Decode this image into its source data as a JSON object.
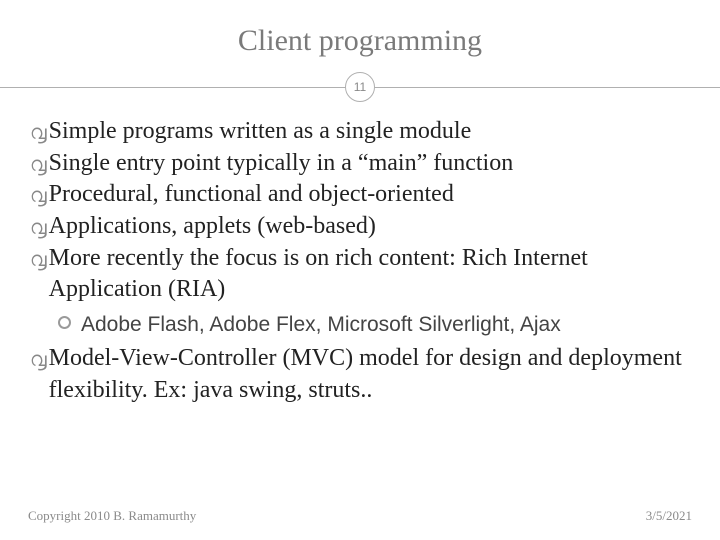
{
  "title": "Client programming",
  "page_number": "11",
  "bullets": [
    {
      "text": "Simple programs written as a single module"
    },
    {
      "text": "Single entry point typically in a “main” function"
    },
    {
      "text": "Procedural, functional and object-oriented"
    },
    {
      "text": "Applications, applets (web-based)"
    },
    {
      "text": "More recently the focus is on rich content: Rich Internet Application (RIA)"
    }
  ],
  "sub_bullet": "Adobe Flash,  Adobe Flex, Microsoft Silverlight, Ajax",
  "bullets2": [
    {
      "text": "Model-View-Controller (MVC) model for design and deployment flexibility. Ex: java swing, struts.."
    }
  ],
  "footer": {
    "copyright": "Copyright 2010 B. Ramamurthy",
    "date": "3/5/2021"
  }
}
